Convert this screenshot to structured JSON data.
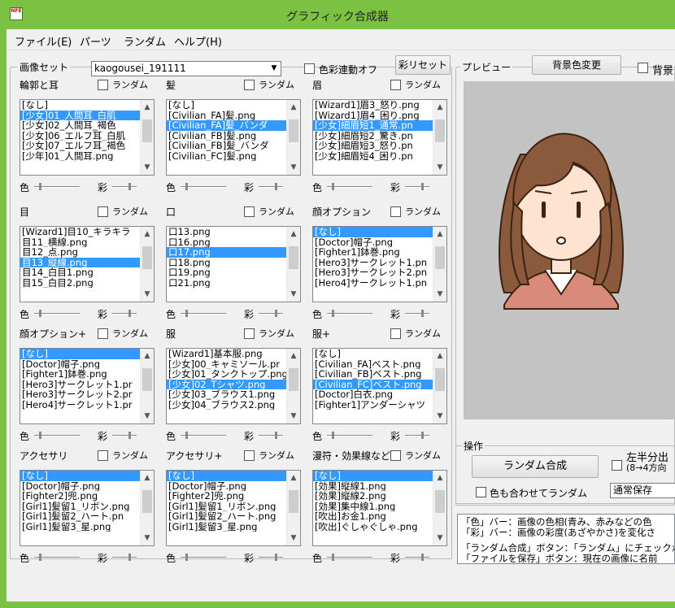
{
  "window": {
    "title": "グラフィック合成器",
    "icon_text": "NFE"
  },
  "menu": [
    "ファイル(E)",
    "パーツ",
    "ランダム",
    "ヘルプ(H)"
  ],
  "image_set": {
    "label": "画像セット",
    "value": "kaogousei_191111",
    "color_link": "色彩連動オフ",
    "color_reset": "彩リセット"
  },
  "common": {
    "random": "ランダム",
    "color": "色",
    "sat": "彩"
  },
  "parts": [
    {
      "title": "輪郭と耳",
      "items": [
        "[なし]",
        "[少女]01_人間耳_白肌",
        "[少女]02_人間耳_褐色",
        "[少女]06_エルフ耳_白肌",
        "[少女]07_エルフ耳_褐色",
        "[少年]01_人間耳.png"
      ],
      "sel": 1
    },
    {
      "title": "髪",
      "items": [
        "[なし]",
        "[Civilian_FA]髪.png",
        "[Civilian_FA]髪_バンダ",
        "[Civilian_FB]髪.png",
        "[Civilian_FB]髪_バンダ",
        "[Civilian_FC]髪.png"
      ],
      "sel": 2
    },
    {
      "title": "眉",
      "items": [
        "[Wizard1]眉3_怒り.png",
        "[Wizard1]眉4_困り.png",
        "[少女]細眉短1_通常.pn",
        "[少女]細眉短2_驚き.pn",
        "[少女]細眉短3_怒り.pn",
        "[少女]細眉短4_困り.pn"
      ],
      "sel": 2
    },
    {
      "title": "目",
      "items": [
        "[Wizard1]目10_キラキラ",
        "目11_横線.png",
        "目12_点.png",
        "目13_縦線.png",
        "目14_白目1.png",
        "目15_白目2.png"
      ],
      "sel": 3
    },
    {
      "title": "口",
      "items": [
        "口13.png",
        "口16.png",
        "口17.png",
        "口18.png",
        "口19.png",
        "口21.png"
      ],
      "sel": 2
    },
    {
      "title": "顔オプション",
      "items": [
        "[なし]",
        "[Doctor]帽子.png",
        "[Fighter1]鉢巻.png",
        "[Hero3]サークレット1.pn",
        "[Hero3]サークレット2.pn",
        "[Hero4]サークレット1.pn"
      ],
      "sel": 0
    },
    {
      "title": "顔オプション+",
      "items": [
        "[なし]",
        "[Doctor]帽子.png",
        "[Fighter1]鉢巻.png",
        "[Hero3]サークレット1.pr",
        "[Hero3]サークレット2.pr",
        "[Hero4]サークレット1.pr"
      ],
      "sel": 0
    },
    {
      "title": "服",
      "items": [
        "[Wizard1]基本服.png",
        "[少女]00_キャミソール.pr",
        "[少女]01_タンクトップ.png",
        "[少女]02_Tシャツ.png",
        "[少女]03_ブラウス1.png",
        "[少女]04_ブラウス2.png"
      ],
      "sel": 3
    },
    {
      "title": "服+",
      "items": [
        "[なし]",
        "[Civilian_FA]ベスト.png",
        "[Civilian_FB]ベスト.png",
        "[Civilian_FC]ベスト.png",
        "[Doctor]白衣.png",
        "[Fighter1]アンダーシャツ"
      ],
      "sel": 3
    },
    {
      "title": "アクセサリ",
      "items": [
        "[なし]",
        "[Doctor]帽子.png",
        "[Fighter2]兜.png",
        "[Girl1]髪留1_リボン.png",
        "[Girl1]髪留2_ハート.pn",
        "[Girl1]髪留3_星.png"
      ],
      "sel": 0
    },
    {
      "title": "アクセサリ+",
      "items": [
        "[なし]",
        "[Doctor]帽子.png",
        "[Fighter2]兜.png",
        "[Girl1]髪留1_リボン.png",
        "[Girl1]髪留2_ハート.png",
        "[Girl1]髪留3_星.png"
      ],
      "sel": 0
    },
    {
      "title": "漫符・効果線など",
      "items": [
        "[なし]",
        "[効果]縦線1.png",
        "[効果]縦線2.png",
        "[効果]集中線1.png",
        "[吹出]お金1.png",
        "[吹出]ぐしゃぐしゃ.png"
      ],
      "sel": 0
    }
  ],
  "preview": {
    "label": "プレビュー",
    "bg_button": "背景色変更",
    "bg_check": "背景",
    "bg_color": "#c3c3c3"
  },
  "ops": {
    "label": "操作",
    "random_btn": "ランダム合成",
    "color_random": "色も合わせてランダム",
    "half_line1": "左半分出",
    "half_line2": "(8→4方向",
    "save_mode": "通常保存"
  },
  "help_lines": [
    "「色」バー：画像の色相(青み、赤みなどの色",
    "「彩」バー：画像の彩度(あざやかさ)を変化さ",
    "",
    "「ランダム合成」ボタン：「ランダム」にチェックが",
    "「ファイルを保存」ボタン：現在の画像に名前"
  ]
}
